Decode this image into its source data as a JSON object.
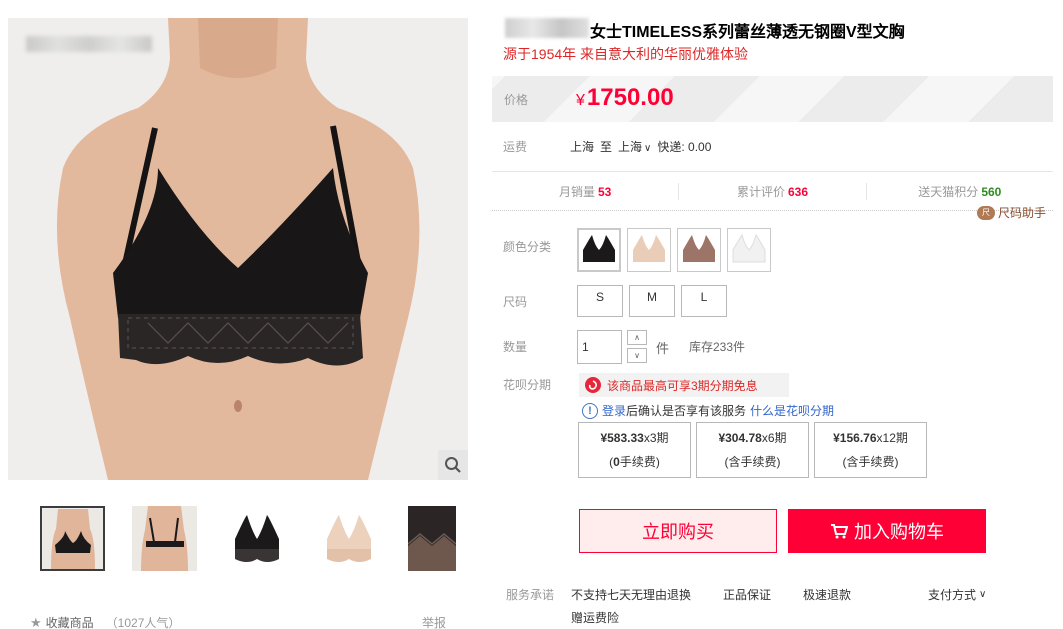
{
  "product": {
    "title": "女士TIMELESS系列蕾丝薄透无钢圈V型文胸",
    "subtitle": "源于1954年 来自意大利的华丽优雅体验"
  },
  "price": {
    "label": "价格",
    "currency": "¥",
    "value": "1750.00"
  },
  "shipping": {
    "label": "运费",
    "from": "上海",
    "to_word": "至",
    "dest": "上海",
    "method": "快递: 0.00"
  },
  "stats": {
    "monthly_sales_label": "月销量",
    "monthly_sales": "53",
    "reviews_label": "累计评价",
    "reviews": "636",
    "points_label": "送天猫积分",
    "points": "560"
  },
  "size_helper": {
    "label": "尺码助手",
    "icon_text": "尺"
  },
  "color": {
    "label": "颜色分类",
    "options": [
      "black",
      "nude",
      "mocha",
      "white"
    ]
  },
  "size": {
    "label": "尺码",
    "options": [
      "S",
      "M",
      "L"
    ]
  },
  "quantity": {
    "label": "数量",
    "value": "1",
    "unit": "件",
    "stock": "库存233件"
  },
  "huabei": {
    "label": "花呗分期",
    "promo": "该商品最高可享3期分期免息",
    "login_text": "登录",
    "info_text": "后确认是否享有该服务",
    "what_link": "什么是花呗分期",
    "plans": [
      {
        "amount": "¥583.33",
        "term": "x3期",
        "fee_open": "(",
        "fee_bold": "0",
        "fee_rest": "手续费)"
      },
      {
        "amount": "¥304.78",
        "term": "x6期",
        "fee_open": "(",
        "fee_bold": "",
        "fee_rest": "含手续费)"
      },
      {
        "amount": "¥156.76",
        "term": "x12期",
        "fee_open": "(",
        "fee_bold": "",
        "fee_rest": "含手续费)"
      }
    ]
  },
  "actions": {
    "buy_now": "立即购买",
    "add_to_cart": "加入购物车"
  },
  "services": {
    "label": "服务承诺",
    "items": [
      "不支持七天无理由退换",
      "正品保证",
      "极速退款",
      "赠运费险"
    ],
    "payment": "支付方式"
  },
  "favorites": {
    "label": "收藏商品",
    "count": "（1027人气）"
  },
  "report": "举报",
  "colors": {
    "accent": "#ff0036",
    "promo_red": "#dd2727",
    "points_green": "#2e8b1e",
    "link_blue": "#3366cc"
  }
}
